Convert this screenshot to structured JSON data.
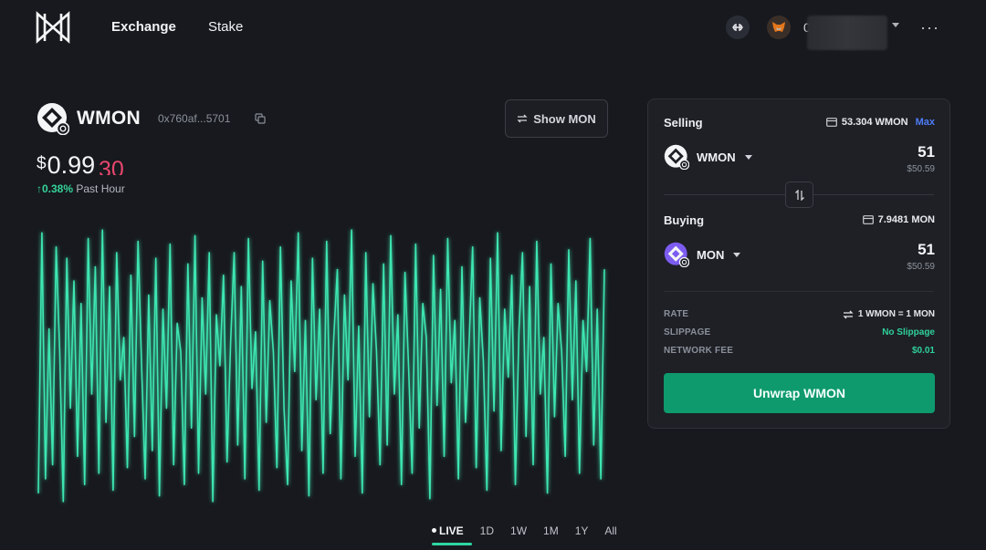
{
  "nav": {
    "exchange_label": "Exchange",
    "stake_label": "Stake"
  },
  "wallet": {
    "address_prefix": "0x",
    "more_label": "···"
  },
  "token": {
    "symbol": "WMON",
    "address_short": "0x760af...5701",
    "price_currency": "$",
    "price_main": "0.99",
    "price_tail": "30",
    "change_value": "↑0.38%",
    "change_period": "Past Hour",
    "show_other_label": "Show MON"
  },
  "chart_data": {
    "type": "line",
    "title": "",
    "xlabel": "",
    "ylabel": "",
    "ylim": [
      0,
      1
    ],
    "grid": false,
    "color": "#3ee6b0",
    "x": [
      0,
      1,
      2,
      3,
      4,
      5,
      6,
      7,
      8,
      9,
      10,
      11,
      12,
      13,
      14,
      15,
      16,
      17,
      18,
      19,
      20,
      21,
      22,
      23,
      24,
      25,
      26,
      27,
      28,
      29,
      30,
      31,
      32,
      33,
      34,
      35,
      36,
      37,
      38,
      39,
      40,
      41,
      42,
      43,
      44,
      45,
      46,
      47,
      48,
      49,
      50,
      51,
      52,
      53,
      54,
      55,
      56,
      57,
      58,
      59,
      60,
      61,
      62,
      63,
      64,
      65,
      66,
      67,
      68,
      69,
      70,
      71,
      72,
      73,
      74,
      75,
      76,
      77,
      78,
      79,
      80,
      81,
      82,
      83,
      84,
      85,
      86,
      87,
      88,
      89,
      90,
      91,
      92,
      93,
      94,
      95,
      96,
      97,
      98,
      99,
      100,
      101,
      102,
      103,
      104,
      105,
      106,
      107,
      108,
      109,
      110,
      111,
      112,
      113,
      114,
      115,
      116,
      117,
      118,
      119,
      120,
      121,
      122,
      123,
      124,
      125,
      126,
      127,
      128,
      129,
      130,
      131,
      132,
      133,
      134,
      135,
      136,
      137,
      138,
      139,
      140,
      141,
      142,
      143,
      144,
      145,
      146,
      147,
      148,
      149,
      150,
      151,
      152,
      153,
      154,
      155,
      156,
      157,
      158,
      159
    ],
    "values": [
      0.05,
      0.97,
      0.1,
      0.63,
      0.15,
      0.92,
      0.55,
      0.02,
      0.88,
      0.35,
      0.8,
      0.18,
      0.72,
      0.08,
      0.95,
      0.4,
      0.85,
      0.12,
      0.98,
      0.3,
      0.78,
      0.06,
      0.9,
      0.45,
      0.6,
      0.14,
      0.82,
      0.25,
      0.94,
      0.5,
      0.1,
      0.75,
      0.2,
      0.88,
      0.04,
      0.7,
      0.35,
      0.93,
      0.15,
      0.65,
      0.55,
      0.08,
      0.86,
      0.28,
      0.96,
      0.12,
      0.74,
      0.4,
      0.9,
      0.02,
      0.68,
      0.5,
      0.82,
      0.16,
      0.58,
      0.9,
      0.22,
      0.78,
      0.1,
      0.95,
      0.42,
      0.62,
      0.06,
      0.87,
      0.3,
      0.73,
      0.55,
      0.14,
      0.92,
      0.35,
      0.08,
      0.8,
      0.48,
      0.97,
      0.2,
      0.66,
      0.04,
      0.88,
      0.38,
      0.7,
      0.12,
      0.94,
      0.26,
      0.6,
      0.84,
      0.1,
      0.75,
      0.45,
      0.98,
      0.18,
      0.64,
      0.05,
      0.9,
      0.32,
      0.79,
      0.55,
      0.15,
      0.86,
      0.22,
      0.96,
      0.4,
      0.68,
      0.08,
      0.83,
      0.5,
      0.12,
      0.93,
      0.28,
      0.72,
      0.6,
      0.03,
      0.89,
      0.36,
      0.77,
      0.18,
      0.95,
      0.44,
      0.66,
      0.1,
      0.85,
      0.3,
      0.58,
      0.92,
      0.14,
      0.74,
      0.52,
      0.06,
      0.88,
      0.34,
      0.97,
      0.2,
      0.7,
      0.46,
      0.82,
      0.08,
      0.62,
      0.9,
      0.25,
      0.78,
      0.15,
      0.94,
      0.4,
      0.6,
      0.05,
      0.86,
      0.32,
      0.72,
      0.55,
      0.18,
      0.91,
      0.38,
      0.8,
      0.12,
      0.66,
      0.48,
      0.95,
      0.22,
      0.7,
      0.1,
      0.84,
      0.35,
      0.15
    ]
  },
  "ranges": [
    {
      "label": "LIVE",
      "active": true
    },
    {
      "label": "1D",
      "active": false
    },
    {
      "label": "1W",
      "active": false
    },
    {
      "label": "1M",
      "active": false
    },
    {
      "label": "1Y",
      "active": false
    },
    {
      "label": "All",
      "active": false
    }
  ],
  "swap": {
    "selling_label": "Selling",
    "selling_balance": "53.304 WMON",
    "max_label": "Max",
    "sell_token": "WMON",
    "sell_amount": "51",
    "sell_usd": "$50.59",
    "buying_label": "Buying",
    "buying_balance": "7.9481 MON",
    "buy_token": "MON",
    "buy_amount": "51",
    "buy_usd": "$50.59",
    "rate_key": "RATE",
    "rate_value": "1 WMON = 1 MON",
    "slippage_key": "SLIPPAGE",
    "slippage_value": "No Slippage",
    "fee_key": "NETWORK FEE",
    "fee_value": "$0.01",
    "cta_label": "Unwrap WMON"
  },
  "colors": {
    "accent_green": "#0e9a6c",
    "line": "#3ee6b0",
    "price_tail": "#e8466c",
    "max_link": "#4e7cf6",
    "background": "#17191e"
  }
}
